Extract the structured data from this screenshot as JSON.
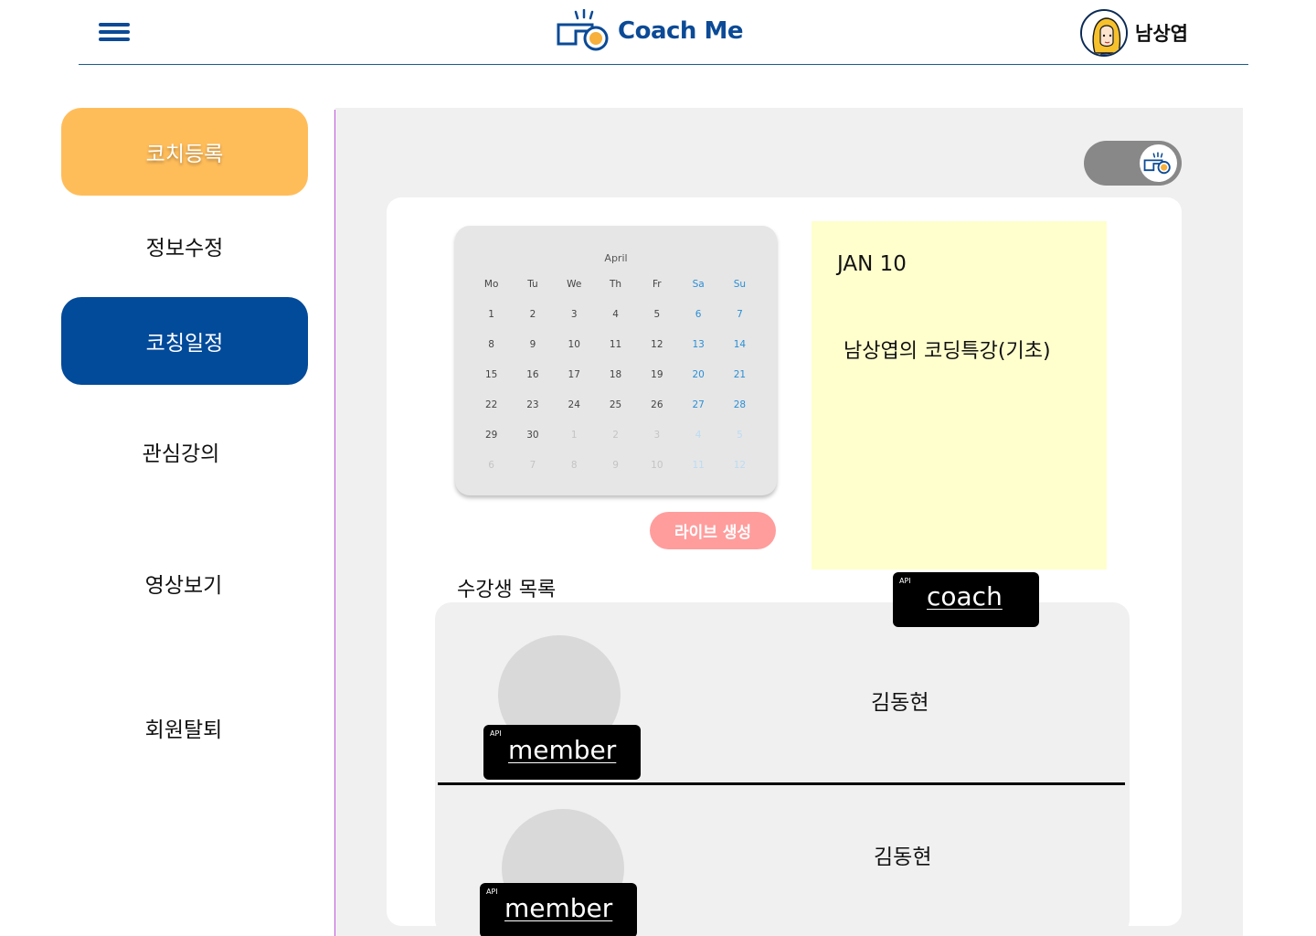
{
  "header": {
    "menu_icon": "hamburger-menu-icon",
    "logo_icon": "whistle-icon",
    "logo_text": "Coach Me",
    "user_name": "남상엽",
    "brand_color": "#0b4a96"
  },
  "sidebar": {
    "items": [
      {
        "label": "코치등록",
        "style": "orange-button",
        "color": "#ffbd5a"
      },
      {
        "label": "정보수정",
        "style": "link"
      },
      {
        "label": "코칭일정",
        "style": "blue-button",
        "color": "#024a9a"
      },
      {
        "label": "관심강의",
        "style": "link"
      },
      {
        "label": "영상보기",
        "style": "link"
      },
      {
        "label": "회원탈퇴",
        "style": "link"
      }
    ]
  },
  "toggle": {
    "icon": "whistle-icon",
    "state": "on"
  },
  "calendar": {
    "month": "April",
    "weekdays": [
      "Mo",
      "Tu",
      "We",
      "Th",
      "Fr",
      "Sa",
      "Su"
    ],
    "weeks": [
      [
        "1",
        "2",
        "3",
        "4",
        "5",
        "6",
        "7"
      ],
      [
        "8",
        "9",
        "10",
        "11",
        "12",
        "13",
        "14"
      ],
      [
        "15",
        "16",
        "17",
        "18",
        "19",
        "20",
        "21"
      ],
      [
        "22",
        "23",
        "24",
        "25",
        "26",
        "27",
        "28"
      ],
      [
        "29",
        "30",
        "1",
        "2",
        "3",
        "4",
        "5"
      ],
      [
        "6",
        "7",
        "8",
        "9",
        "10",
        "11",
        "12"
      ]
    ],
    "weekend_color": "#2a8fd6"
  },
  "live_button": {
    "label": "라이브 생성",
    "color": "#ff9d9d"
  },
  "note": {
    "date": "JAN 10",
    "title": "남상엽의 코딩특강(기초)",
    "color": "#ffffcd"
  },
  "coach_api": {
    "tag": "API",
    "label": "coach"
  },
  "student_list": {
    "title": "수강생 목록",
    "members": [
      {
        "name": "김동현",
        "api_tag": "API",
        "api_label": "member"
      },
      {
        "name": "김동현",
        "api_tag": "API",
        "api_label": "member"
      }
    ]
  }
}
